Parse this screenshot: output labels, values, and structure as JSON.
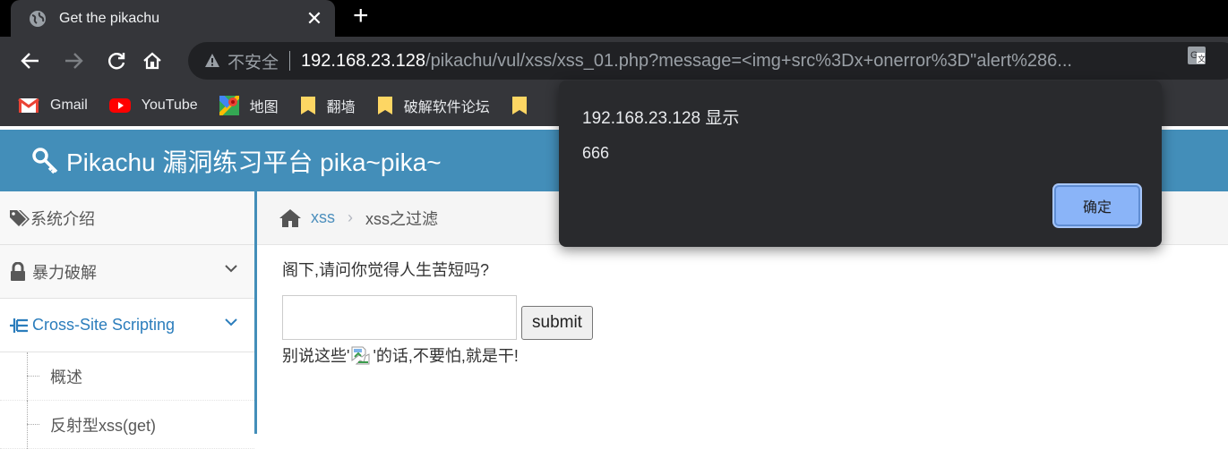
{
  "browser": {
    "tab_title": "Get the pikachu",
    "new_tab": "+",
    "address": {
      "insecure_label": "不安全",
      "host": "192.168.23.128",
      "path": "/pikachu/vul/xss/xss_01.php?message=<img+src%3Dx+onerror%3D\"alert%286..."
    },
    "bookmarks": [
      {
        "label": "Gmail"
      },
      {
        "label": "YouTube"
      },
      {
        "label": "地图"
      },
      {
        "label": "翻墙"
      },
      {
        "label": "破解软件论坛"
      }
    ]
  },
  "site": {
    "brand": "Pikachu 漏洞练习平台 pika~pika~"
  },
  "sidebar": {
    "items": [
      {
        "label": "系统介绍"
      },
      {
        "label": "暴力破解"
      },
      {
        "label": "Cross-Site Scripting"
      }
    ],
    "sub_items": [
      {
        "label": "概述"
      },
      {
        "label": "反射型xss(get)"
      }
    ]
  },
  "breadcrumb": {
    "link": "xss",
    "sep": "›",
    "current": "xss之过滤"
  },
  "content": {
    "question": "阁下,请问你觉得人生苦短吗?",
    "input_value": "",
    "submit_label": "submit",
    "result_before": "别说这些'",
    "result_after": "'的话,不要怕,就是干!"
  },
  "dialog": {
    "title": "192.168.23.128 显示",
    "message": "666",
    "ok_label": "确定"
  },
  "colors": {
    "brand_blue": "#438eb9",
    "link_blue": "#2b7dbc",
    "dialog_bg": "#292a2d",
    "ok_button": "#8ab4f8"
  }
}
